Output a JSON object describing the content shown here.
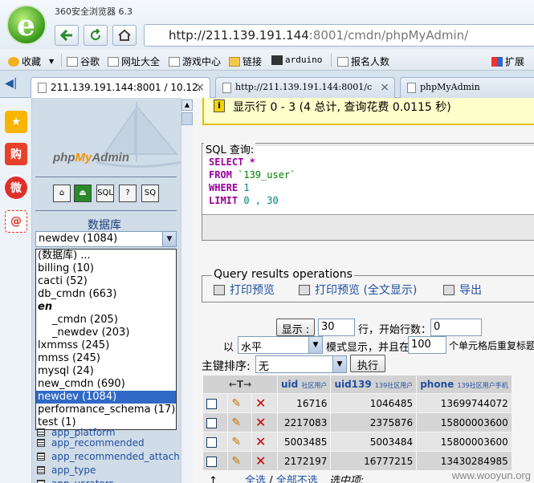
{
  "browser": {
    "app_title": "360安全浏览器 6.3",
    "address_host": "http://211.139.191.144",
    "address_rest": ":8001/cmdn/phpMyAdmin/",
    "bookmarks": [
      "收藏",
      "谷歌",
      "网址大全",
      "游戏中心",
      "链接",
      "arduino",
      "报名人数",
      "扩展"
    ],
    "tabs": [
      {
        "label": "211.139.191.144:8001 / 10.12.",
        "active": true
      },
      {
        "label": "http://211.139.191.144:8001/c",
        "active": false
      },
      {
        "label": "phpMyAdmin",
        "active": false
      }
    ]
  },
  "nav": {
    "logo_php": "php",
    "logo_my": "My",
    "logo_admin": "Admin",
    "db_label": "数据库",
    "selected_db": "newdev (1084)",
    "db_options": [
      {
        "label": "(数据库) ...",
        "type": "normal"
      },
      {
        "label": "billing (10)",
        "type": "normal"
      },
      {
        "label": "cacti (52)",
        "type": "normal"
      },
      {
        "label": "db_cmdn (663)",
        "type": "normal"
      },
      {
        "label": "en",
        "type": "group"
      },
      {
        "label": "_cmdn (205)",
        "type": "indent"
      },
      {
        "label": "_newdev (203)",
        "type": "indent"
      },
      {
        "label": "lxmmss (245)",
        "type": "normal"
      },
      {
        "label": "mmss (245)",
        "type": "normal"
      },
      {
        "label": "mysql (24)",
        "type": "normal"
      },
      {
        "label": "new_cmdn (690)",
        "type": "normal"
      },
      {
        "label": "newdev (1084)",
        "type": "selected"
      },
      {
        "label": "performance_schema (17)",
        "type": "normal"
      },
      {
        "label": "test (1)",
        "type": "normal"
      }
    ],
    "tables": [
      "app_platform",
      "app_recommended",
      "app_recommended_attach",
      "app_type",
      "app_usrators"
    ]
  },
  "main": {
    "notice": "显示行 0 - 3 (4 总计, 查询花费 0.0115 秒)",
    "sql_legend": "SQL 查询:",
    "sql": {
      "select": "SELECT",
      "star": " *",
      "from": "FROM",
      "table": " `139_user`",
      "where": "WHERE",
      "where_val": " 1",
      "limit": "LIMIT",
      "limit_val": " 0 , 30"
    },
    "qro_legend": "Query results operations",
    "qro_links": [
      "打印预览",
      "打印预览 (全文显示)",
      "导出"
    ],
    "show_button": "显示 :",
    "rows_value": "30",
    "start_label": "行，开始行数：",
    "start_value": "0",
    "in_label": "以",
    "mode_value": "水平",
    "mode_label": "模式显示，并且在",
    "repeat_value": "100",
    "repeat_label": "个单元格后重复标题",
    "sort_label": "主键排序:",
    "sort_value": "无",
    "exec_button": "执行",
    "columns": [
      {
        "name": "uid",
        "comment": "社区用户"
      },
      {
        "name": "uid139",
        "comment": "139社区用户"
      },
      {
        "name": "phone",
        "comment": "139社区用户手机"
      }
    ],
    "rows": [
      {
        "uid": "16716",
        "uid139": "1046485",
        "phone": "13699744072"
      },
      {
        "uid": "2217083",
        "uid139": "2375876",
        "phone": "15800003600"
      },
      {
        "uid": "5003485",
        "uid139": "5003484",
        "phone": "15800003600"
      },
      {
        "uid": "2172197",
        "uid139": "16777215",
        "phone": "13430284985"
      }
    ],
    "check_all": "全选",
    "uncheck_all": "全部不选",
    "with_selected": "选中项:",
    "watermark": "www.wooyun.org"
  },
  "colors": {
    "link": "#1f4fa0",
    "selected_option": "#3169c6",
    "notice_bg": "#ffffcc",
    "sql_keyword": "#990099"
  }
}
